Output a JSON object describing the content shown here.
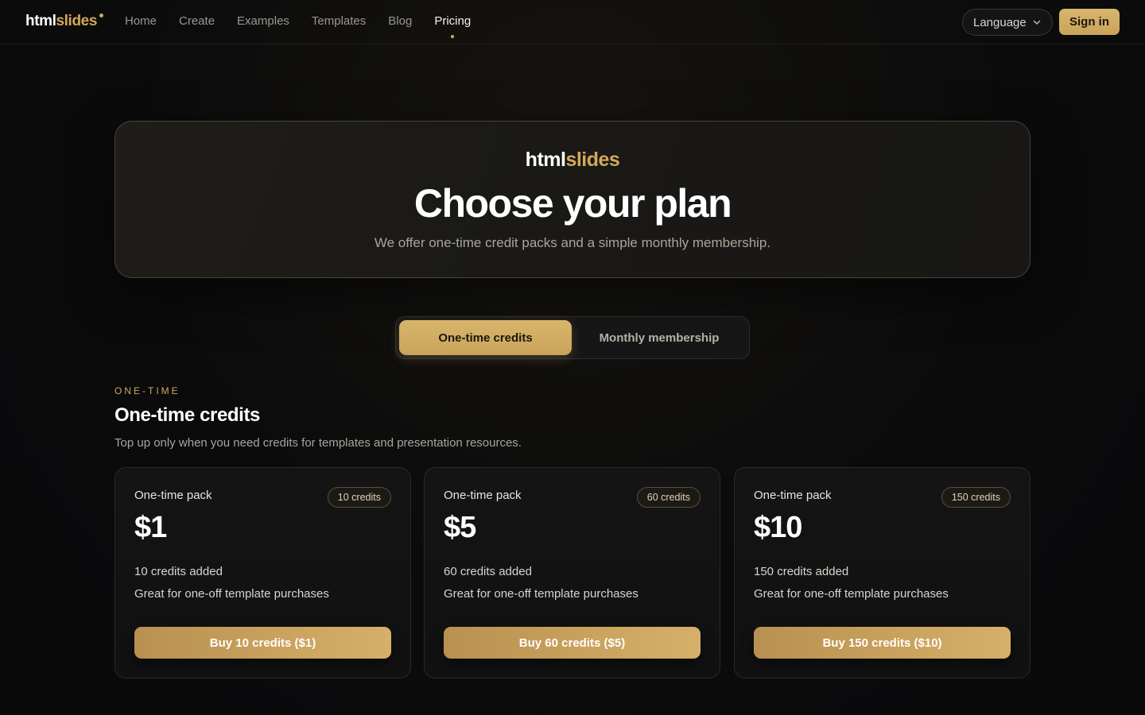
{
  "brand": {
    "part1": "html",
    "part2": "slides"
  },
  "nav": {
    "links": [
      "Home",
      "Create",
      "Examples",
      "Templates",
      "Blog",
      "Pricing"
    ],
    "active": "Pricing",
    "language_label": "Language",
    "signin_label": "Sign in"
  },
  "hero": {
    "title": "Choose your plan",
    "subtitle": "We offer one-time credit packs and a simple monthly membership."
  },
  "toggle": {
    "options": [
      "One-time credits",
      "Monthly membership"
    ],
    "selected": "One-time credits"
  },
  "section": {
    "eyebrow": "ONE-TIME",
    "title": "One-time credits",
    "description": "Top up only when you need credits for templates and presentation resources."
  },
  "cards": [
    {
      "label": "One-time pack",
      "badge": "10 credits",
      "price": "$1",
      "credits": "10 credits added",
      "description": "Great for one-off template purchases",
      "button": "Buy 10 credits ($1)"
    },
    {
      "label": "One-time pack",
      "badge": "60 credits",
      "price": "$5",
      "credits": "60 credits added",
      "description": "Great for one-off template purchases",
      "button": "Buy 60 credits ($5)"
    },
    {
      "label": "One-time pack",
      "badge": "150 credits",
      "price": "$10",
      "credits": "150 credits added",
      "description": "Great for one-off template purchases",
      "button": "Buy 150 credits ($10)"
    }
  ],
  "colors": {
    "accent": "#d2a85a",
    "background": "#0b0b0c"
  },
  "icons": {
    "language_chevron": "chevron-down-icon",
    "brand_dot": "dot-icon"
  }
}
